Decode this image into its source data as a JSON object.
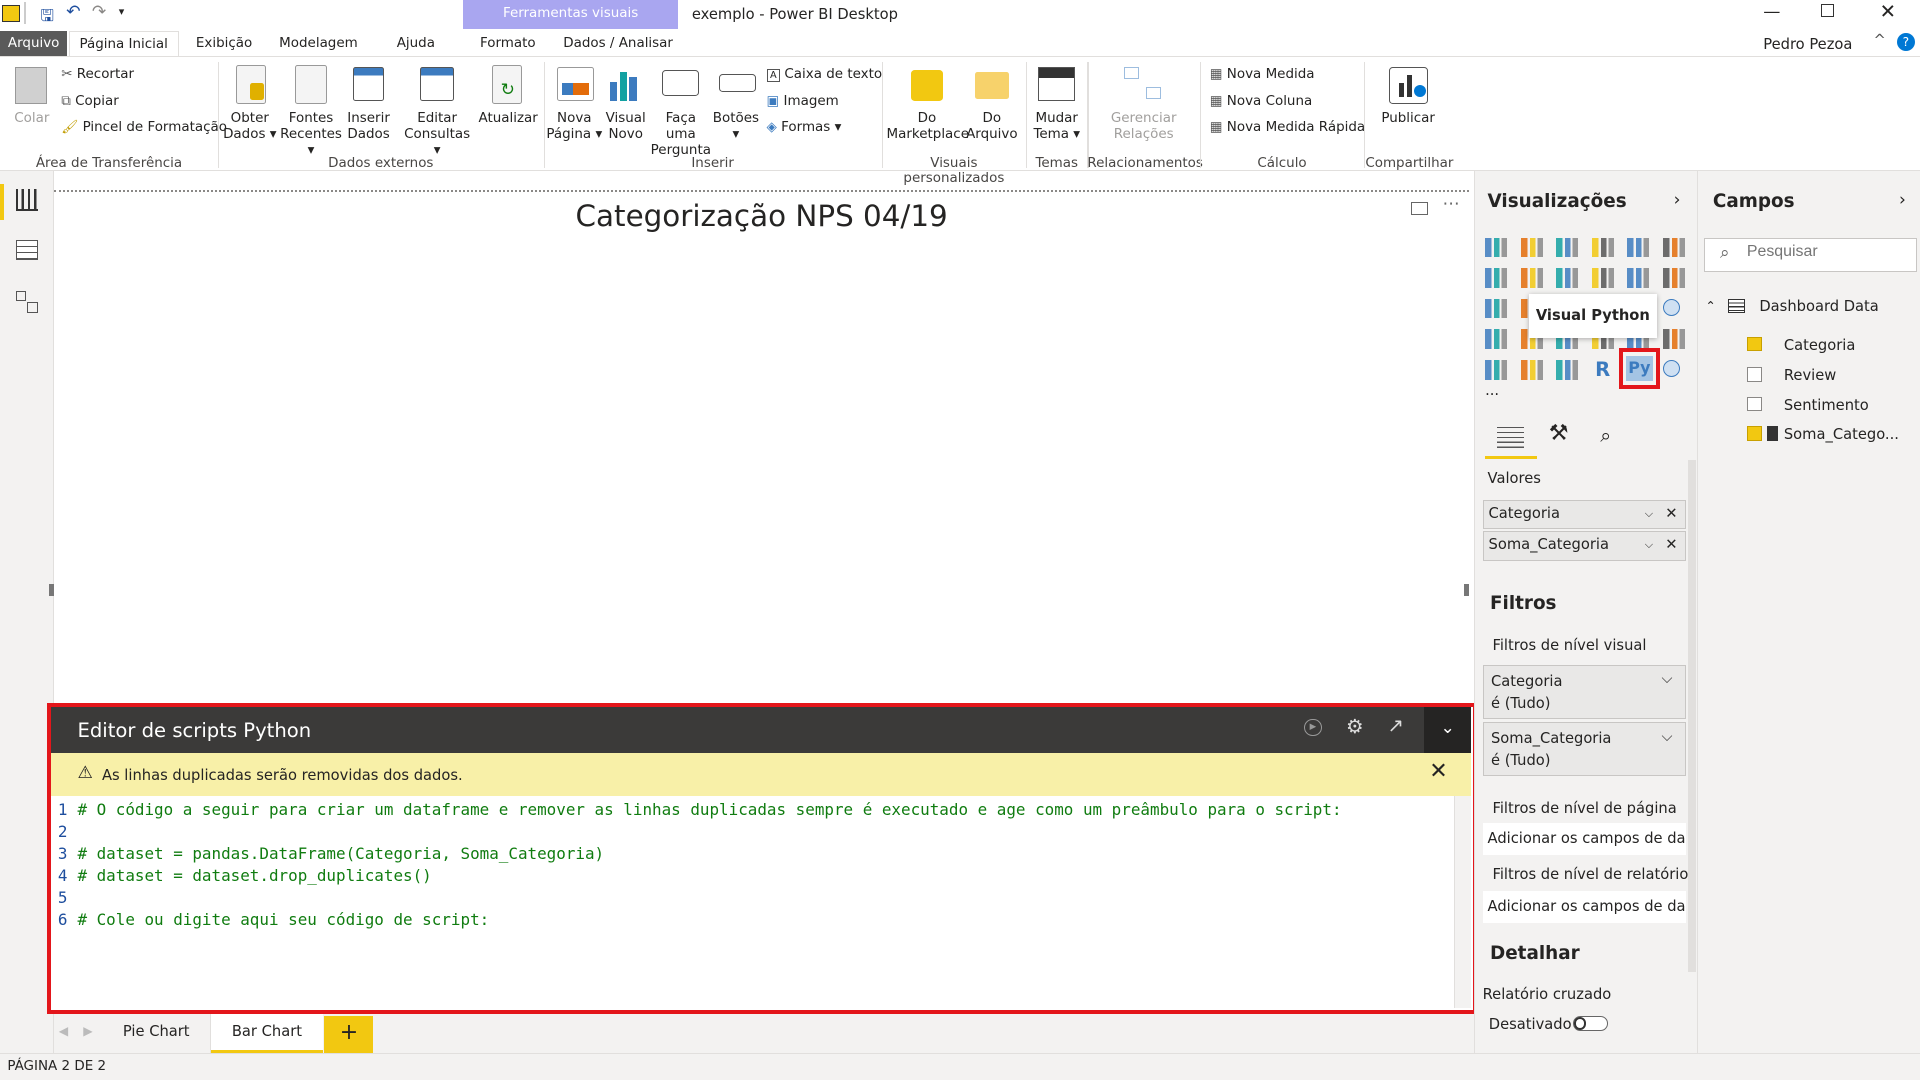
{
  "titlebar": {
    "file_label": "exemplo - Power BI Desktop",
    "context_tab": "Ferramentas visuais",
    "user": "Pedro Pezoa"
  },
  "tabs": [
    "Arquivo",
    "Página Inicial",
    "Exibição",
    "Modelagem",
    "Ajuda",
    "Formato",
    "Dados / Analisar"
  ],
  "ribbon": {
    "clipboard": {
      "paste": "Colar",
      "cut": "Recortar",
      "copy": "Copiar",
      "format_painter": "Pincel de Formatação",
      "group": "Área de Transferência"
    },
    "external": {
      "get_data_1": "Obter",
      "get_data_2": "Dados",
      "recent_1": "Fontes",
      "recent_2": "Recentes",
      "enter_1": "Inserir",
      "enter_2": "Dados",
      "edit_1": "Editar",
      "edit_2": "Consultas",
      "refresh": "Atualizar",
      "group": "Dados externos"
    },
    "insert": {
      "new_page_1": "Nova",
      "new_page_2": "Página",
      "new_visual_1": "Visual",
      "new_visual_2": "Novo",
      "ask_1": "Faça uma",
      "ask_2": "Pergunta",
      "buttons": "Botões",
      "textbox": "Caixa de texto",
      "image": "Imagem",
      "shapes": "Formas",
      "group": "Inserir"
    },
    "custom": {
      "market_1": "Do",
      "market_2": "Marketplace",
      "file_1": "Do",
      "file_2": "Arquivo",
      "group": "Visuais personalizados"
    },
    "themes": {
      "switch_1": "Mudar",
      "switch_2": "Tema",
      "group": "Temas"
    },
    "rel": {
      "manage_1": "Gerenciar",
      "manage_2": "Relações",
      "group": "Relacionamentos"
    },
    "calc": {
      "measure": "Nova Medida",
      "column": "Nova Coluna",
      "quick": "Nova Medida Rápida",
      "group": "Cálculo"
    },
    "share": {
      "publish": "Publicar",
      "group": "Compartilhar"
    }
  },
  "canvas": {
    "title": "Categorização NPS 04/19"
  },
  "editor": {
    "title": "Editor de scripts Python",
    "warning": "As linhas duplicadas serão removidas dos dados.",
    "lines": [
      {
        "n": "1",
        "text": "# O código a seguir para criar um dataframe e remover as linhas duplicadas sempre é executado e age como um preâmbulo para o script:"
      },
      {
        "n": "2",
        "text": ""
      },
      {
        "n": "3",
        "text": "# dataset = pandas.DataFrame(Categoria, Soma_Categoria)"
      },
      {
        "n": "4",
        "text": "# dataset = dataset.drop_duplicates()"
      },
      {
        "n": "5",
        "text": ""
      },
      {
        "n": "6",
        "text": "# Cole ou digite aqui seu código de script:"
      }
    ]
  },
  "pages": {
    "tabs": [
      "Pie Chart",
      "Bar Chart"
    ],
    "add": "+",
    "status": "PÁGINA 2 DE 2"
  },
  "viz": {
    "title": "Visualizações",
    "tooltip": "Visual Python",
    "more": "...",
    "values_label": "Valores",
    "wells": [
      "Categoria",
      "Soma_Categoria"
    ],
    "filters_title": "Filtros",
    "visual_filters": "Filtros de nível visual",
    "filter_cards": [
      {
        "name": "Categoria",
        "state": "é (Tudo)"
      },
      {
        "name": "Soma_Categoria",
        "state": "é (Tudo)"
      }
    ],
    "page_filters": "Filtros de nível de página",
    "add_fields_1": "Adicionar os campos de da...",
    "report_filters": "Filtros de nível de relatório",
    "add_fields_2": "Adicionar os campos de da...",
    "drill_title": "Detalhar",
    "cross": "Relatório cruzado",
    "off": "Desativado"
  },
  "fields": {
    "title": "Campos",
    "search_placeholder": "Pesquisar",
    "table": "Dashboard Data",
    "items": [
      {
        "name": "Categoria",
        "checked": true
      },
      {
        "name": "Review",
        "checked": false
      },
      {
        "name": "Sentimento",
        "checked": false
      },
      {
        "name": "Soma_Catego...",
        "checked": true
      }
    ]
  },
  "colors": {
    "accent": "#f2c811",
    "highlight": "#e3161b",
    "context": "#a9a6f0",
    "code": "#107c10"
  }
}
